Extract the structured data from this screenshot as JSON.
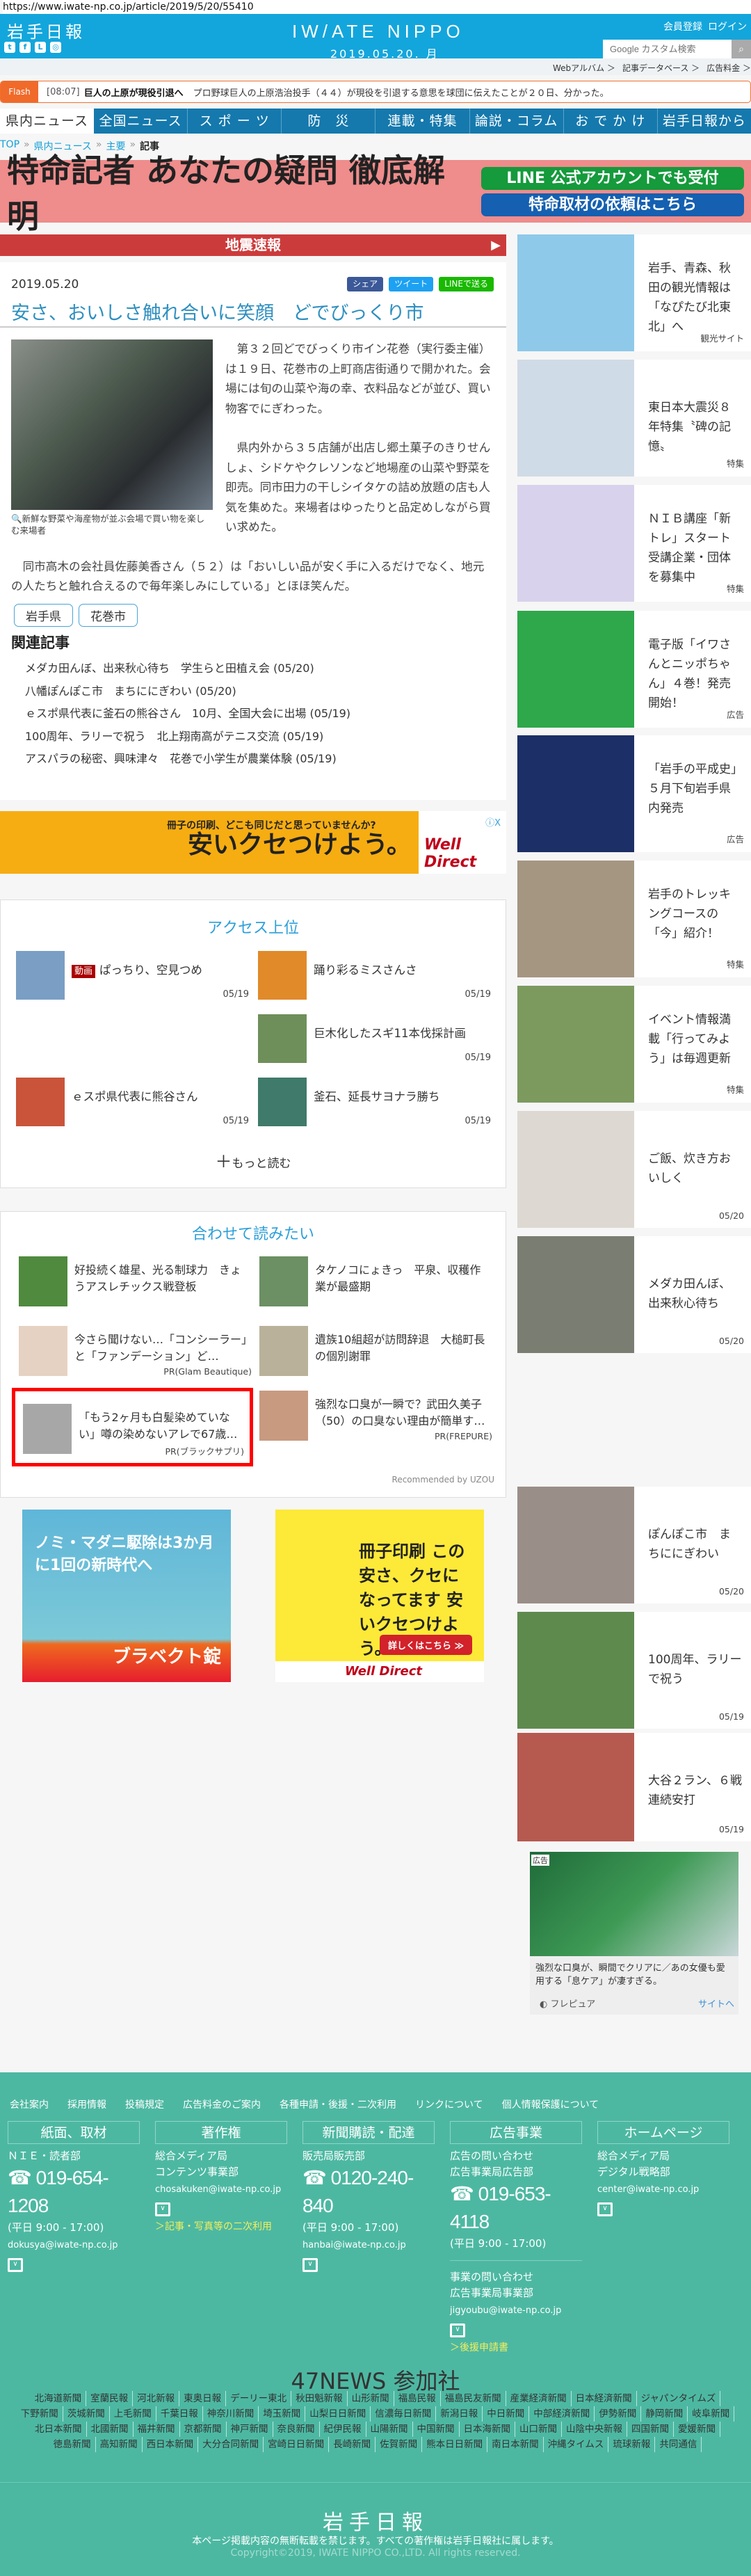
{
  "url": "https://www.iwate-np.co.jp/article/2019/5/20/55410",
  "header": {
    "logo": "岩手日報",
    "brand": "IW/ATE NIPPO",
    "date": "2019.05.20. 月",
    "register": "会員登録",
    "login": "ログイン",
    "search_placeholder": "Google カスタム検索",
    "social": [
      "twitter",
      "facebook",
      "line",
      "instagram"
    ],
    "accent": "#13a6dc"
  },
  "subbar": [
    "Webアルバム ＞",
    "記事データベース ＞",
    "広告料金 ＞"
  ],
  "flash": {
    "label": "Flash",
    "time": "[08:07]",
    "headline": "巨人の上原が現役引退へ",
    "text": "プロ野球巨人の上原浩治投手（４４）が現役を引退する意思を球団に伝えたことが２０日、分かった。"
  },
  "nav": [
    "県内ニュース",
    "全国ニュース",
    "ス ポ ー ツ",
    "防　災",
    "連載・特集",
    "論説・コラム",
    "お で か け",
    "岩手日報から"
  ],
  "breadcrumb": {
    "items": [
      "TOP",
      "県内ニュース",
      "主要"
    ],
    "current": "記事"
  },
  "banner": {
    "text": "特命記者 あなたの疑問 徹底解明",
    "line": "LINE 公式アカウントでも受付",
    "request": "特命取材の依頼はこちら"
  },
  "quake": "地震速報",
  "article": {
    "date": "2019.05.20",
    "share": [
      "シェア",
      "ツイート",
      "LINEで送る"
    ],
    "title": "安さ、おいしさ触れ合いに笑顔　どでびっくり市",
    "caption": "新鮮な野菜や海産物が並ぶ会場で買い物を楽しむ来場者",
    "paragraphs": [
      "　第３２回どでびっくり市イン花巻（実行委主催）は１９日、花巻市の上町商店街通りで開かれた。会場には旬の山菜や海の幸、衣料品などが並び、買い物客でにぎわった。",
      "　県内外から３５店舗が出店し郷土菓子のきりせんしょ、シドケやクレソンなど地場産の山菜や野菜を即売。同市田力の干しシイタケの詰め放題の店も人気を集めた。来場者はゆったりと品定めしながら買い求めた。",
      "　同市高木の会社員佐藤美香さん（５２）は「おいしい品が安く手に入るだけでなく、地元の人たちと触れ合えるので毎年楽しみにしている」とほほ笑んだ。"
    ],
    "tags": [
      "岩手県",
      "花巻市"
    ],
    "related_heading": "関連記事",
    "related": [
      "メダカ田んぼ、出来秋心待ち　学生らと田植え会 (05/20)",
      "八幡ぽんぽこ市　まちににぎわい (05/20)",
      "ｅスポ県代表に釜石の熊谷さん　10月、全国大会に出場 (05/19)",
      "100周年、ラリーで祝う　北上翔南高がテニス交流 (05/19)",
      "アスパラの秘密、興味津々　花巻で小学生が農業体験 (05/19)"
    ]
  },
  "ad_banner": {
    "headline": "安いクセつけよう。",
    "sub": "冊子の印刷、どこも同じだと思っていませんか?",
    "brand": "Well Direct",
    "close": "ⓘX"
  },
  "access": {
    "title": "アクセス上位",
    "badge": "動画",
    "items": [
      {
        "title": "ぱっちり、空見つめ",
        "date": "05/19",
        "video": true
      },
      {
        "title": "踊り彩るミスさんさ",
        "date": "05/19"
      },
      {
        "title": "巨木化したスギ11本伐採計画",
        "date": "05/19"
      },
      {
        "title": "ｅスポ県代表に熊谷さん",
        "date": "05/19"
      },
      {
        "title": "釜石、延長サヨナラ勝ち",
        "date": "05/19"
      }
    ],
    "more": "もっと読む"
  },
  "recommend": {
    "title": "合わせて読みたい",
    "items": [
      {
        "title": "好投続く雄星、光る制球力　きょうアスレチックス戦登板",
        "pr": ""
      },
      {
        "title": "タケノコにょきっ　平泉、収穫作業が最盛期",
        "pr": ""
      },
      {
        "title": "今さら聞けない…「コンシーラー」と「ファンデーション」ど…",
        "pr": "PR(Glam Beautique)"
      },
      {
        "title": "遺族10組超が訪問辞退　大槌町長の個別謝罪",
        "pr": ""
      },
      {
        "title": "「もう2ヶ月も白髪染めていない」噂の染めないアレで67歳…",
        "pr": "PR(ブラックサプリ)"
      },
      {
        "title": "強烈な口臭が一瞬で？武田久美子（50）の口臭ない理由が簡単す…",
        "pr": "PR(FREPURE)"
      }
    ],
    "credit": "Recommended by UZOU"
  },
  "ads_bottom": [
    {
      "text": "ノミ・マダニ駆除は3か月に1回の新時代へ",
      "brand": "ブラベクト錠"
    },
    {
      "text": "冊子印刷 この安さ、クセになってます 安いクセつけよう。",
      "button": "詳しくはこちら ≫",
      "brand": "Well Direct"
    }
  ],
  "sidebar": [
    {
      "text": "岩手、青森、秋田の観光情報は「なぴたび北東北」へ",
      "label": "観光サイト",
      "color": "#8ec9ea"
    },
    {
      "text": "東日本大震災８年特集〝碑の記憶〟",
      "label": "特集",
      "color": "#cfdbe6"
    },
    {
      "text": "ＮＩＢ講座「新トレ」スタート　受講企業・団体を募集中",
      "label": "特集",
      "color": "#d9d2ec"
    },
    {
      "text": "電子版「イワさんとニッポちゃん」４巻！発売開始！",
      "label": "広告",
      "color": "#2ea84a"
    },
    {
      "text": "「岩手の平成史」５月下旬岩手県内発売",
      "label": "広告",
      "color": "#1c2f66"
    },
    {
      "text": "岩手のトレッキングコースの「今」紹介！",
      "label": "特集",
      "color": "#a59682"
    },
    {
      "text": "イベント情報満載「行ってみよう」は毎週更新",
      "label": "特集",
      "color": "#7c9a5e"
    },
    {
      "text": "ご飯、炊き方おいしく",
      "label": "05/20",
      "color": "#ddd9d2"
    },
    {
      "text": "メダカ田んぼ、出来秋心待ち",
      "label": "05/20",
      "color": "#7a7d72"
    },
    {
      "text": "ぽんぽこ市　まちににぎわい",
      "label": "05/20",
      "color": "#9a8f88"
    },
    {
      "text": "100周年、ラリーで祝う",
      "label": "05/19",
      "color": "#5f8a4e"
    },
    {
      "text": "大谷２ラン、６戦連続安打",
      "label": "05/19",
      "color": "#b65a50"
    }
  ],
  "side_ad": {
    "tag": "広告",
    "text": "強烈な口臭が、瞬間でクリアに／あの女優も愛用する「息ケア」が凄すぎる。",
    "source": "フレピュア",
    "link": "サイトへ"
  },
  "footer": {
    "links": [
      "会社案内",
      "採用情報",
      "投稿規定",
      "広告料金のご案内",
      "各種申請・後援・二次利用",
      "リンクについて",
      "個人情報保護について"
    ],
    "cols": [
      {
        "head": "紙面、取材",
        "lines": [
          "ＮＩＥ・読者部"
        ],
        "tel": "019-654-1208",
        "hours": "(平日 9:00 - 17:00)",
        "mail": "dokusya@iwate-np.co.jp"
      },
      {
        "head": "著作権",
        "lines": [
          "総合メディア局",
          "コンテンツ事業部"
        ],
        "mail": "chosakuken@iwate-np.co.jp",
        "link": "＞記事・写真等の二次利用"
      },
      {
        "head": "新聞購読・配達",
        "lines": [
          "販売局販売部"
        ],
        "tel": "0120-240-840",
        "hours": "(平日 9:00 - 17:00)",
        "mail": "hanbai@iwate-np.co.jp"
      },
      {
        "head": "広告事業",
        "lines": [
          "広告の問い合わせ",
          "広告事業局広告部"
        ],
        "tel": "019-653-4118",
        "hours": "(平日 9:00 - 17:00)",
        "lines2": [
          "事業の問い合わせ",
          "広告事業局事業部"
        ],
        "mail": "jigyoubu@iwate-np.co.jp",
        "link": "＞後援申請書"
      },
      {
        "head": "ホームページ",
        "lines": [
          "総合メディア局",
          "デジタル戦略部"
        ],
        "mail": "center@iwate-np.co.jp"
      }
    ],
    "news47_title": "47NEWS 参加社",
    "news47": [
      "北海道新聞",
      "室蘭民報",
      "河北新報",
      "東奥日報",
      "デーリー東北",
      "秋田魁新報",
      "山形新聞",
      "福島民報",
      "福島民友新聞",
      "産業経済新聞",
      "日本経済新聞",
      "ジャパンタイムズ",
      "下野新聞",
      "茨城新聞",
      "上毛新聞",
      "千葉日報",
      "神奈川新聞",
      "埼玉新聞",
      "山梨日日新聞",
      "信濃毎日新聞",
      "新潟日報",
      "中日新聞",
      "中部経済新聞",
      "伊勢新聞",
      "静岡新聞",
      "岐阜新聞",
      "北日本新聞",
      "北國新聞",
      "福井新聞",
      "京都新聞",
      "神戸新聞",
      "奈良新聞",
      "紀伊民報",
      "山陽新聞",
      "中国新聞",
      "日本海新聞",
      "山口新聞",
      "山陰中央新報",
      "四国新聞",
      "愛媛新聞",
      "徳島新聞",
      "高知新聞",
      "西日本新聞",
      "大分合同新聞",
      "宮崎日日新聞",
      "長崎新聞",
      "佐賀新聞",
      "熊本日日新聞",
      "南日本新聞",
      "沖縄タイムス",
      "琉球新報",
      "共同通信"
    ],
    "logo": "岩手日報",
    "note": "本ページ掲載内容の無断転載を禁じます。すべての著作権は岩手日報社に属します。",
    "copyright": "Copyright©2019, IWATE NIPPO CO.,LTD. All rights reserved.",
    "bg": "#4db8a2"
  }
}
